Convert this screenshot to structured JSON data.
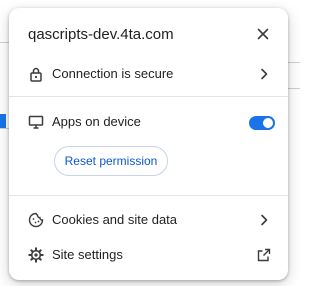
{
  "popup": {
    "title": "qascripts-dev.4ta.com",
    "connection": {
      "label": "Connection is secure",
      "icon": "lock-icon"
    },
    "apps": {
      "label": "Apps on device",
      "icon": "monitor-icon",
      "toggle_on": true
    },
    "reset_button": "Reset permission",
    "cookies": {
      "label": "Cookies and site data",
      "icon": "cookie-icon"
    },
    "site_settings": {
      "label": "Site settings",
      "icon": "gear-icon"
    }
  },
  "colors": {
    "accent": "#1a73e8",
    "button_text": "#0b57d0",
    "text": "#1f1f1f",
    "separator": "#e3e3e3"
  }
}
